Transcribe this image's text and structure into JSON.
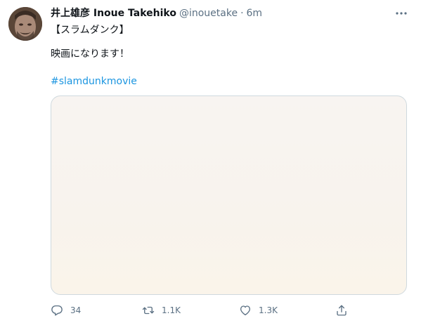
{
  "tweet": {
    "display_name": "井上雄彦 Inoue Takehiko",
    "handle": "@inouetake",
    "separator": "·",
    "time": "6m",
    "text_lines": [
      "【スラムダンク】",
      "映画になります！"
    ],
    "hashtag": "#slamdunkmovie"
  },
  "actions": {
    "reply_count": "34",
    "retweet_count": "1.1K",
    "like_count": "1.3K"
  },
  "icons": {
    "more": "more-dots-icon",
    "reply": "reply-bubble-icon",
    "retweet": "retweet-arrows-icon",
    "like": "heart-icon",
    "share": "share-upload-icon"
  },
  "colors": {
    "link": "#1b95e0",
    "secondary_text": "#5b7083",
    "primary_text": "#0f1419",
    "media_border": "#cfd9de",
    "media_fill": "#f8f4f0"
  }
}
